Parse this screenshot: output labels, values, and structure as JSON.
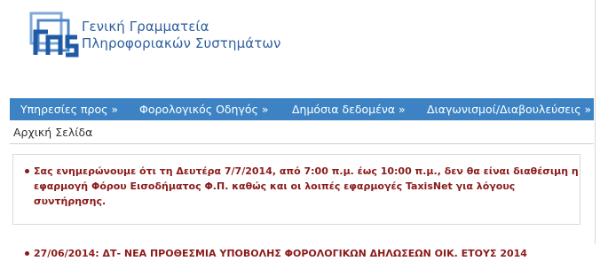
{
  "colors": {
    "brand_blue": "#2f5f9e",
    "nav_bar": "#3d83c4",
    "notice_text": "#8b1a1a"
  },
  "header": {
    "logo_icon": "gsis-logo-icon",
    "org_name_line1": "Γενική Γραμματεία",
    "org_name_line2": "Πληροφοριακών Συστημάτων"
  },
  "nav": {
    "items": [
      {
        "label": "Υπηρεσίες προς »"
      },
      {
        "label": "Φορολογικός Οδηγός »"
      },
      {
        "label": "Δημόσια δεδομένα »"
      },
      {
        "label": "Διαγωνισμοί/Διαβουλεύσεις »"
      }
    ]
  },
  "breadcrumb": {
    "home": "Αρχική Σελίδα"
  },
  "notices": {
    "items": [
      {
        "text": "Σας ενημερώνουμε ότι τη Δευτέρα 7/7/2014, από 7:00 π.μ. έως 10:00 π.μ., δεν θα είναι διαθέσιμη η εφαρμογή Φόρου Εισοδήματος Φ.Π. καθώς και οι λοιπές εφαρμογές TaxisNet για λόγους συντήρησης."
      },
      {
        "text": "27/06/2014: ΔΤ- ΝΕΑ ΠΡΟΘΕΣΜΙΑ ΥΠΟΒΟΛΗΣ ΦΟΡΟΛΟΓΙΚΩΝ ΔΗΛΩΣΕΩΝ ΟΙΚ. ΕΤΟΥΣ 2014"
      }
    ]
  }
}
